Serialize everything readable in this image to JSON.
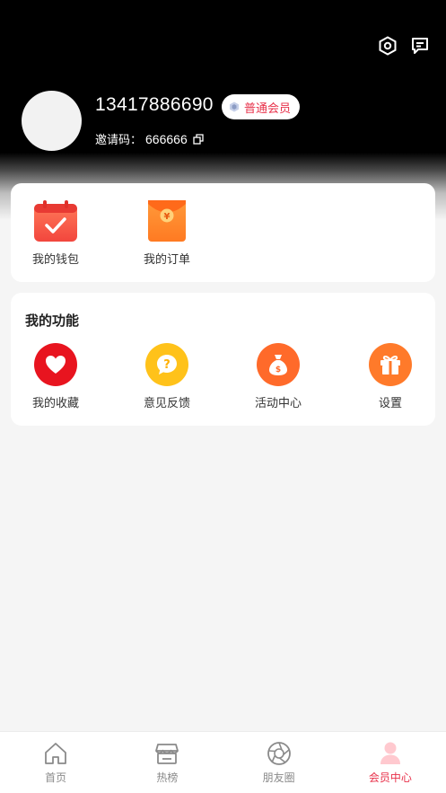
{
  "header": {
    "phone": "13417886690",
    "member_badge": "普通会员",
    "invite_label": "邀请码：",
    "invite_code": "666666"
  },
  "quick": {
    "items": [
      {
        "label": "我的钱包",
        "icon": "wallet-calendar-icon"
      },
      {
        "label": "我的订单",
        "icon": "red-envelope-icon"
      }
    ]
  },
  "functions": {
    "title": "我的功能",
    "items": [
      {
        "label": "我的收藏",
        "icon": "heart-icon",
        "color": "#e8141f"
      },
      {
        "label": "意见反馈",
        "icon": "question-bubble-icon",
        "color": "#ffc21a"
      },
      {
        "label": "活动中心",
        "icon": "money-bag-icon",
        "color": "#ff6a2a"
      },
      {
        "label": "设置",
        "icon": "gift-icon",
        "color": "#ff7a2a"
      }
    ]
  },
  "tabbar": {
    "items": [
      {
        "label": "首页",
        "icon": "home-icon"
      },
      {
        "label": "热榜",
        "icon": "store-icon"
      },
      {
        "label": "朋友圈",
        "icon": "aperture-icon"
      },
      {
        "label": "会员中心",
        "icon": "user-icon",
        "active": true
      }
    ]
  },
  "colors": {
    "accent": "#e8314a",
    "hero": "#000000"
  }
}
